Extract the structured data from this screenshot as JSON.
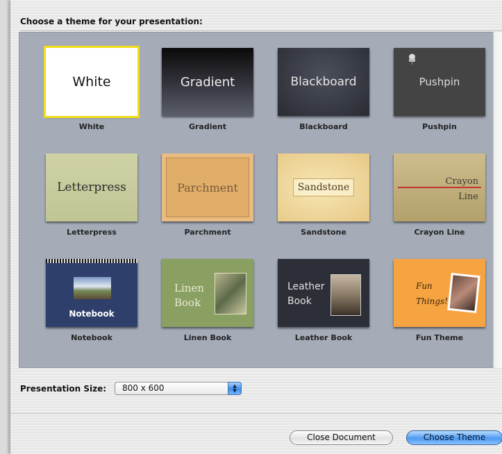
{
  "dialog": {
    "header": "Choose a theme for your presentation:",
    "themes": [
      {
        "thumb_title": "White",
        "label": "White",
        "selected": true
      },
      {
        "thumb_title": "Gradient",
        "label": "Gradient"
      },
      {
        "thumb_title": "Blackboard",
        "label": "Blackboard"
      },
      {
        "thumb_title": "Pushpin",
        "label": "Pushpin"
      },
      {
        "thumb_title": "Letterpress",
        "label": "Letterpress"
      },
      {
        "thumb_title": "Parchment",
        "label": "Parchment"
      },
      {
        "thumb_title": "Sandstone",
        "label": "Sandstone"
      },
      {
        "thumb_title_1": "Crayon",
        "thumb_title_2": "Line",
        "label": "Crayon Line"
      },
      {
        "thumb_title": "Notebook",
        "label": "Notebook"
      },
      {
        "thumb_title_1": "Linen",
        "thumb_title_2": "Book",
        "label": "Linen Book"
      },
      {
        "thumb_title_1": "Leather",
        "thumb_title_2": "Book",
        "label": "Leather Book"
      },
      {
        "thumb_title_1": "Fun",
        "thumb_title_2": "Things!",
        "label": "Fun Theme"
      }
    ],
    "size_label": "Presentation Size:",
    "size_value": "800 x 600",
    "close_button": "Close Document",
    "choose_button": "Choose Theme",
    "colors": {
      "panel": "#a5acb8",
      "selection": "#f2dc19",
      "default_button": "#4e9af0"
    }
  }
}
